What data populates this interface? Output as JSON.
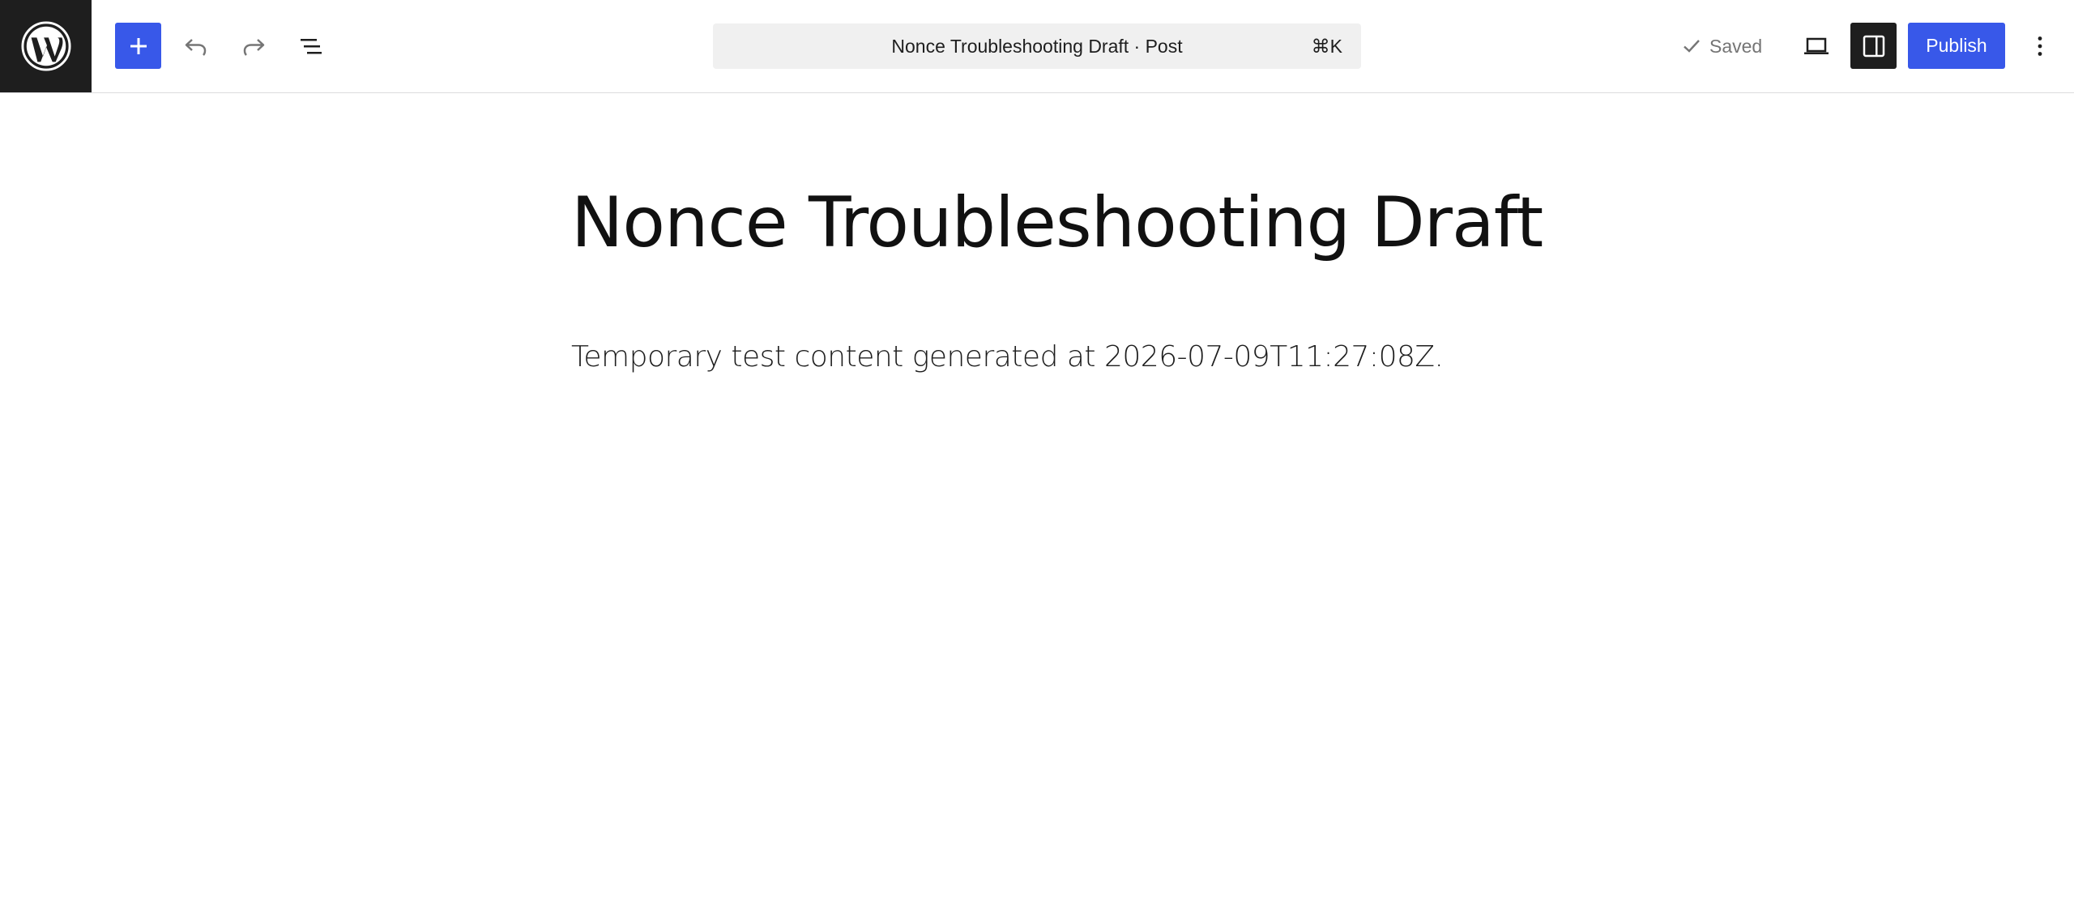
{
  "toolbar": {
    "logo": "wordpress-logo",
    "add_block": {
      "icon": "plus-icon",
      "color": "#3858e9"
    },
    "undo": {
      "icon": "undo-icon"
    },
    "redo": {
      "icon": "redo-icon"
    },
    "list_view": {
      "icon": "list-view-icon"
    },
    "command_bar": {
      "title": "Nonce Troubleshooting Draft · Post",
      "shortcut": "⌘K"
    },
    "status": {
      "icon": "check-icon",
      "label": "Saved"
    },
    "view": {
      "icon": "desktop-view-icon"
    },
    "settings": {
      "icon": "sidebar-toggle-icon",
      "active": true
    },
    "publish_label": "Publish",
    "options": {
      "icon": "more-vertical-icon"
    }
  },
  "post": {
    "title": "Nonce Troubleshooting Draft",
    "paragraph": "Temporary test content generated at 2026-07-09T11:27:08Z."
  },
  "colors": {
    "accent": "#3858e9",
    "dark": "#1e1e1e",
    "muted": "#757575",
    "surface": "#f0f0f0"
  }
}
